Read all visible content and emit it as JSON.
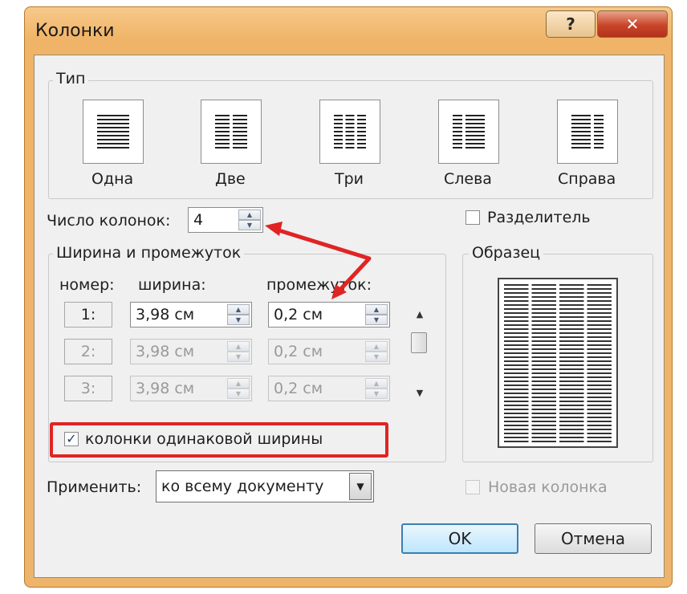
{
  "window": {
    "title": "Колонки",
    "help_label": "?",
    "close_label": "✕"
  },
  "type_group": {
    "title": "Тип",
    "presets": [
      {
        "id": "one",
        "label": "Одна"
      },
      {
        "id": "two",
        "label": "Две"
      },
      {
        "id": "three",
        "label": "Три"
      },
      {
        "id": "left",
        "label": "Слева"
      },
      {
        "id": "right",
        "label": "Справа"
      }
    ]
  },
  "num_columns": {
    "label": "Число колонок:",
    "value": "4"
  },
  "separator": {
    "label": "Разделитель",
    "checked": false
  },
  "width_group": {
    "title": "Ширина и промежуток",
    "col_number_header": "номер:",
    "col_width_header": "ширина:",
    "col_spacing_header": "промежуток:",
    "rows": [
      {
        "number": "1:",
        "width": "3,98 см",
        "spacing": "0,2 см",
        "enabled": true
      },
      {
        "number": "2:",
        "width": "3,98 см",
        "spacing": "0,2 см",
        "enabled": false
      },
      {
        "number": "3:",
        "width": "3,98 см",
        "spacing": "0,2 см",
        "enabled": false
      }
    ]
  },
  "equal_width": {
    "label": "колонки одинаковой ширины",
    "checked": true
  },
  "preview": {
    "title": "Образец",
    "columns": 4
  },
  "apply": {
    "label": "Применить:",
    "value": "ко всему документу"
  },
  "new_column": {
    "label": "Новая колонка",
    "checked": false
  },
  "buttons": {
    "ok": "OK",
    "cancel": "Отмена"
  },
  "annotation_color": "#e02424"
}
